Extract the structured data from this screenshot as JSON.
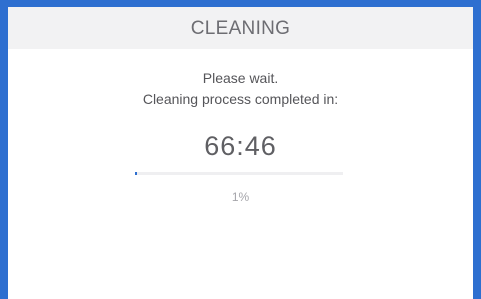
{
  "header": {
    "title": "CLEANING"
  },
  "main": {
    "line1": "Please wait.",
    "line2": "Cleaning process completed in:",
    "timer": "66:46",
    "progress_percent": 1,
    "progress_label": "1%"
  },
  "colors": {
    "accent": "#2e6fd0",
    "header_bg": "#f2f2f3",
    "text": "#555559"
  }
}
